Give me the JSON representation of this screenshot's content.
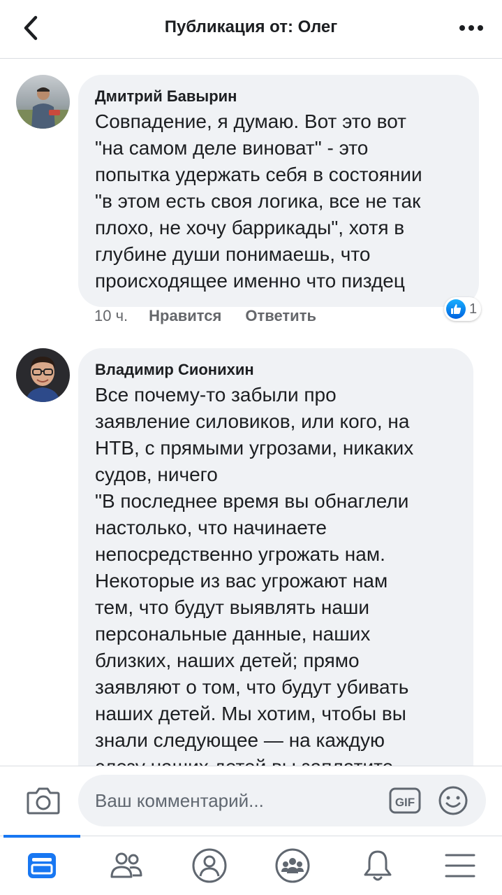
{
  "header": {
    "title": "Публикация от: Олег",
    "back_icon": "chevron-left-icon",
    "more_icon": "more-horizontal-icon"
  },
  "comments": [
    {
      "author": "Дмитрий Бавырин",
      "text": "Совпадение, я думаю. Вот это вот\n\"на самом деле виноват\" - это\nпопытка удержать себя в состоянии\n\"в этом есть своя логика, все не так\nплохо, не хочу баррикады\", хотя в\nглубине души понимаешь, что\nпроисходящее именно что пиздец",
      "time": "10 ч.",
      "like_label": "Нравится",
      "reply_label": "Ответить",
      "reaction_count": "1",
      "reaction_icon": "like-reaction-icon"
    },
    {
      "author": "Владимир Сионихин",
      "text": "Все почему-то забыли про\nзаявление силовиков, или кого, на\nНТВ, с прямыми угрозами, никаких\nсудов, ничего\n\"В последнее время вы обнаглели\nнастолько, что начинаете\nнепосредственно угрожать нам.\nНекоторые из вас угрожают нам\nтем, что будут выявлять наши\nперсональные данные, наших\nблизких, наших детей; прямо\nзаявляют о том, что будут убивать\nнаших детей. Мы хотим, чтобы вы\nзнали следующее — на каждую\nслезу наших детей вы заплатите"
    }
  ],
  "composer": {
    "placeholder": "Ваш комментарий...",
    "camera_icon": "camera-icon",
    "gif_label": "GIF",
    "emoji_icon": "emoji-icon"
  },
  "tabs": [
    {
      "name": "news-feed",
      "icon": "news-feed-icon",
      "active": true
    },
    {
      "name": "friends",
      "icon": "friends-icon",
      "active": false
    },
    {
      "name": "profile",
      "icon": "profile-icon",
      "active": false
    },
    {
      "name": "groups",
      "icon": "groups-icon",
      "active": false
    },
    {
      "name": "notifications",
      "icon": "bell-icon",
      "active": false
    },
    {
      "name": "menu",
      "icon": "menu-icon",
      "active": false
    }
  ],
  "colors": {
    "accent": "#1877f2",
    "bubble": "#f0f2f5",
    "secondary_text": "#65676b",
    "icon": "#606770"
  }
}
